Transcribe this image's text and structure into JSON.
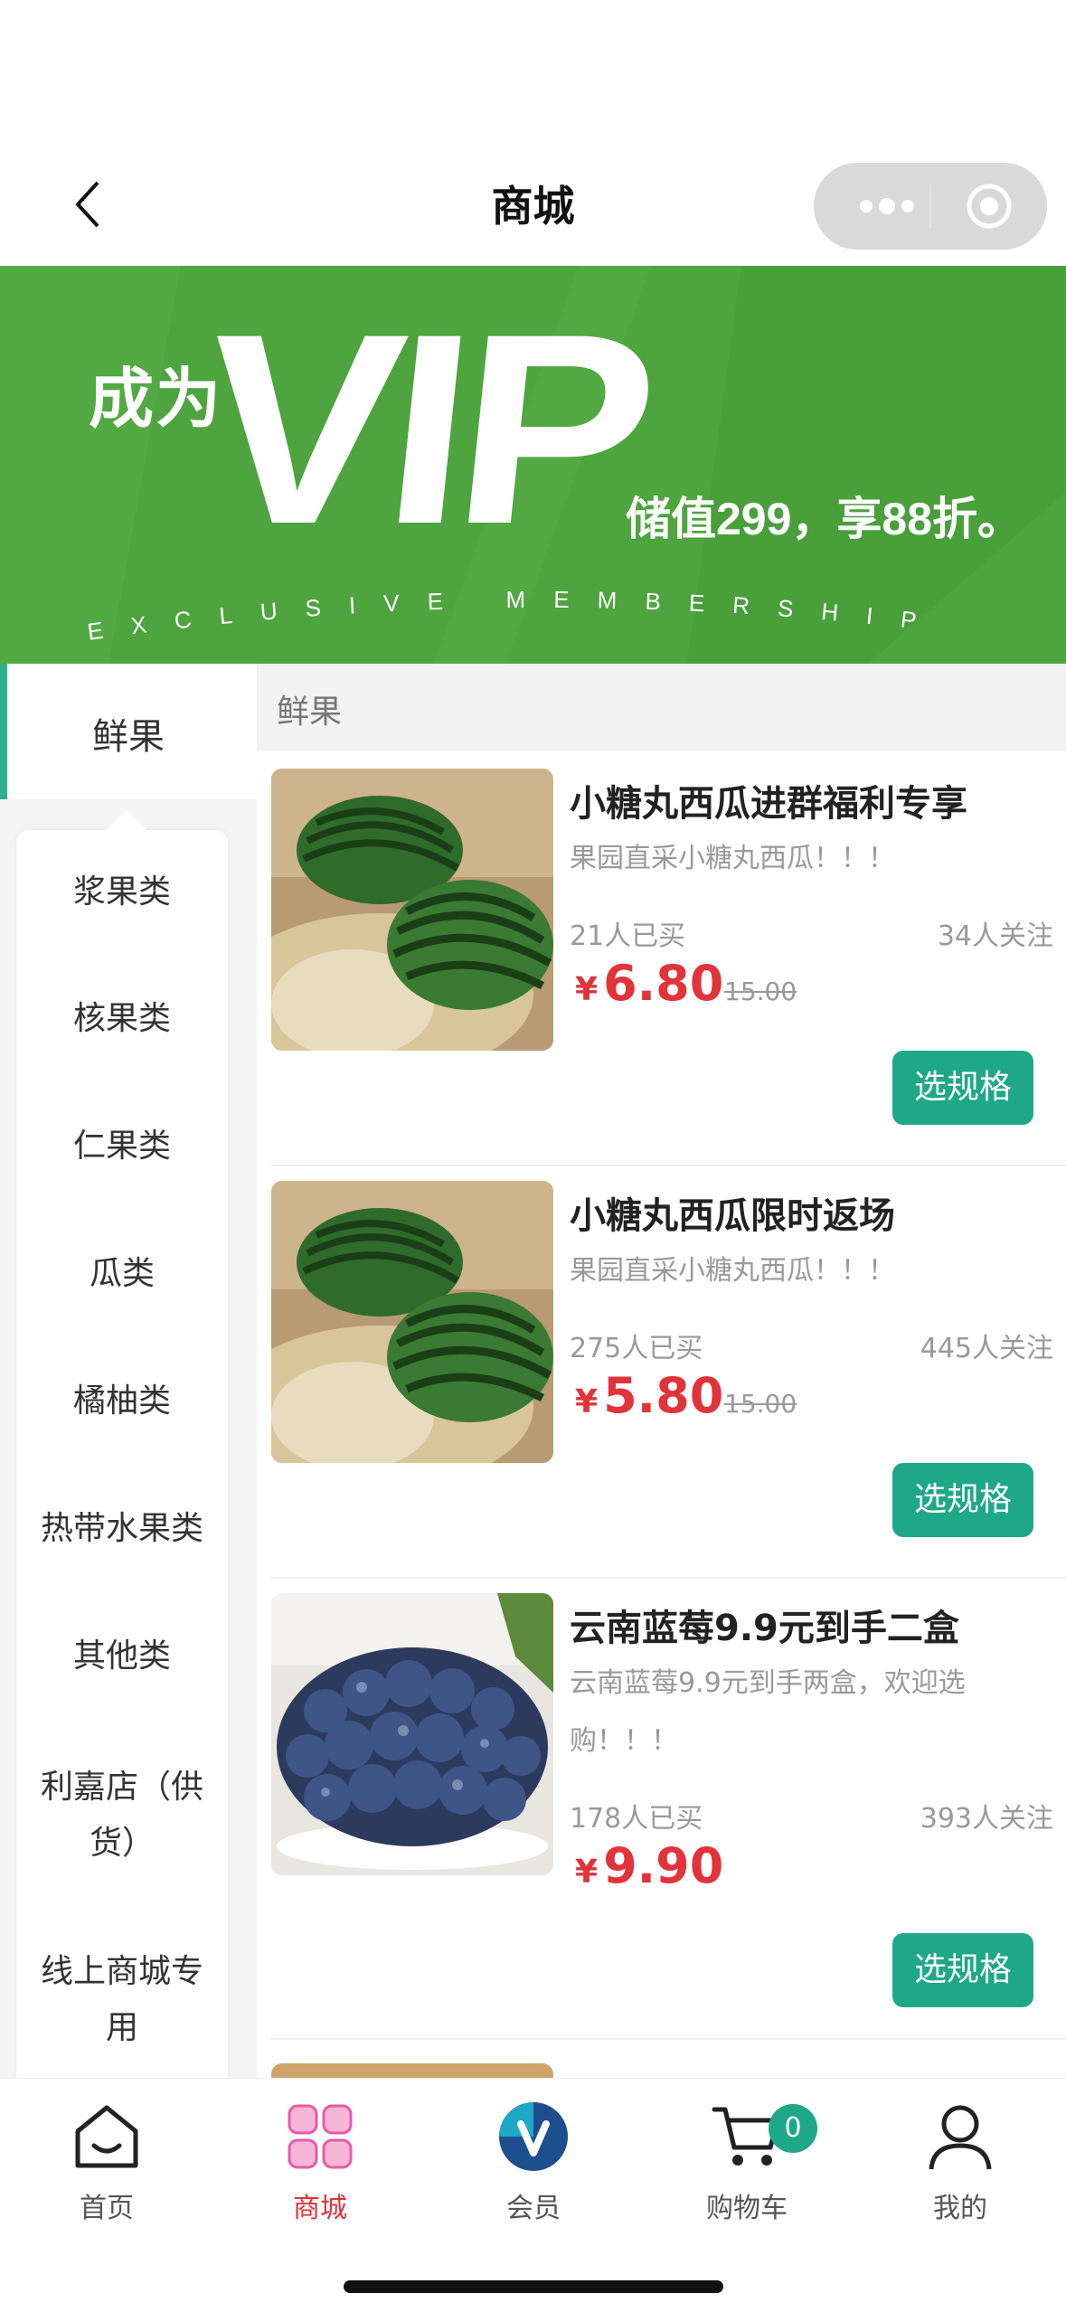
{
  "nav": {
    "title": "商城"
  },
  "banner": {
    "become": "成为",
    "vip": "VIP",
    "store_value": "储值299，享88折。",
    "exclusive": "EXCLUSIVE MEMBERSHIP"
  },
  "sidebar": {
    "active": "鲜果",
    "items": [
      "浆果类",
      "核果类",
      "仁果类",
      "瓜类",
      "橘柚类",
      "热带水果类",
      "其他类",
      "利嘉店（供",
      "货）",
      "线上商城专",
      "用"
    ]
  },
  "category_header": "鲜果",
  "products": [
    {
      "title": "小糖丸西瓜进群福利专享",
      "desc": "果园直采小糖丸西瓜！！！",
      "sold": "21人已买",
      "follow": "34人关注",
      "yen": "¥",
      "price": "6.80",
      "orig": "15.00",
      "button": "选规格"
    },
    {
      "title": "小糖丸西瓜限时返场",
      "desc": "果园直采小糖丸西瓜！！！",
      "sold": "275人已买",
      "follow": "445人关注",
      "yen": "¥",
      "price": "5.80",
      "orig": "15.00",
      "button": "选规格"
    },
    {
      "title": "云南蓝莓9.9元到手二盒",
      "desc": "云南蓝莓9.9元到手两盒，欢迎选购！！！",
      "sold": "178人已买",
      "follow": "393人关注",
      "yen": "¥",
      "price": "9.90",
      "orig": "",
      "button": "选规格"
    }
  ],
  "tabbar": {
    "items": [
      "首页",
      "商城",
      "会员",
      "购物车",
      "我的"
    ],
    "cart_badge": "0",
    "active_color": "#e0333a",
    "accent_color": "#1ea888"
  }
}
